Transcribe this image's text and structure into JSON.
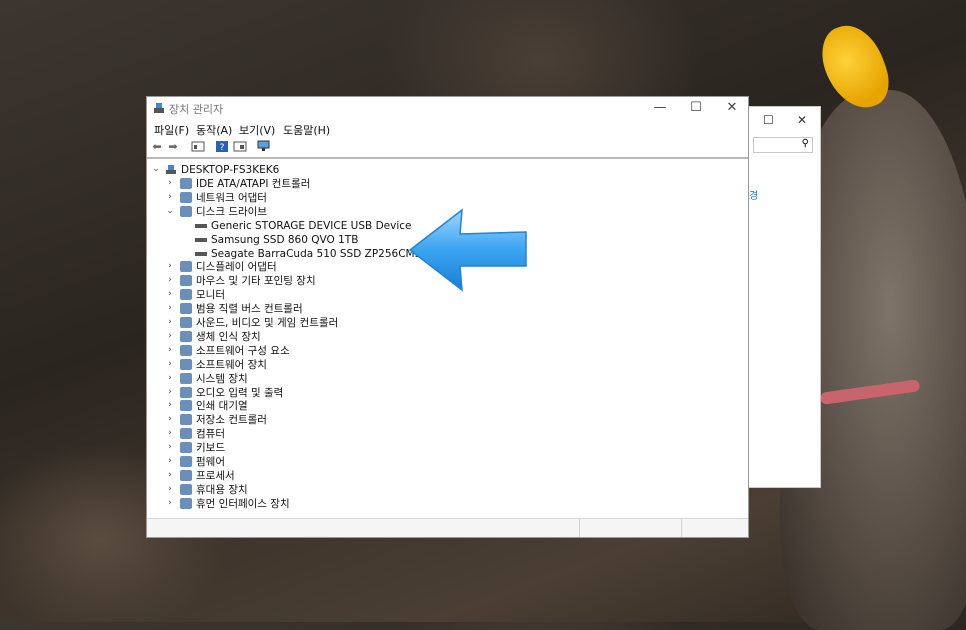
{
  "window": {
    "title": "장치 관리자",
    "controls": {
      "minimize": "—",
      "maximize": "☐",
      "close": "✕"
    }
  },
  "back_window": {
    "controls": {
      "maximize": "☐",
      "close": "✕"
    },
    "link_fragment": "경"
  },
  "menu": {
    "items": [
      {
        "label": "파일(F)"
      },
      {
        "label": "동작(A)"
      },
      {
        "label": "보기(V)"
      },
      {
        "label": "도움말(H)"
      }
    ]
  },
  "tree": {
    "root": "DESKTOP-FS3KEK6",
    "nodes": [
      {
        "label": "IDE ATA/ATAPI 컨트롤러",
        "icon": "ide-controller-icon",
        "expanded": false
      },
      {
        "label": "네트워크 어댑터",
        "icon": "network-adapter-icon",
        "expanded": false
      },
      {
        "label": "디스크 드라이브",
        "icon": "disk-drive-icon",
        "expanded": true,
        "children": [
          {
            "label": "Generic STORAGE DEVICE USB Device"
          },
          {
            "label": "Samsung SSD 860 QVO 1TB"
          },
          {
            "label": "Seagate BarraCuda 510 SSD ZP256CM30011"
          }
        ]
      },
      {
        "label": "디스플레이 어댑터",
        "icon": "display-adapter-icon",
        "expanded": false
      },
      {
        "label": "마우스 및 기타 포인팅 장치",
        "icon": "mouse-icon",
        "expanded": false
      },
      {
        "label": "모니터",
        "icon": "monitor-icon",
        "expanded": false
      },
      {
        "label": "범용 직렬 버스 컨트롤러",
        "icon": "usb-controller-icon",
        "expanded": false
      },
      {
        "label": "사운드, 비디오 및 게임 컨트롤러",
        "icon": "sound-icon",
        "expanded": false
      },
      {
        "label": "생체 인식 장치",
        "icon": "biometric-icon",
        "expanded": false
      },
      {
        "label": "소프트웨어 구성 요소",
        "icon": "software-component-icon",
        "expanded": false
      },
      {
        "label": "소프트웨어 장치",
        "icon": "software-device-icon",
        "expanded": false
      },
      {
        "label": "시스템 장치",
        "icon": "system-device-icon",
        "expanded": false
      },
      {
        "label": "오디오 입력 및 출력",
        "icon": "audio-io-icon",
        "expanded": false
      },
      {
        "label": "인쇄 대기열",
        "icon": "print-queue-icon",
        "expanded": false
      },
      {
        "label": "저장소 컨트롤러",
        "icon": "storage-controller-icon",
        "expanded": false
      },
      {
        "label": "컴퓨터",
        "icon": "computer-icon",
        "expanded": false
      },
      {
        "label": "키보드",
        "icon": "keyboard-icon",
        "expanded": false
      },
      {
        "label": "펌웨어",
        "icon": "firmware-icon",
        "expanded": false
      },
      {
        "label": "프로세서",
        "icon": "processor-icon",
        "expanded": false
      },
      {
        "label": "휴대용 장치",
        "icon": "portable-device-icon",
        "expanded": false
      },
      {
        "label": "휴먼 인터페이스 장치",
        "icon": "hid-icon",
        "expanded": false
      }
    ]
  },
  "colors": {
    "accent": "#1e90e8",
    "arrow": "#3aa4f0"
  }
}
